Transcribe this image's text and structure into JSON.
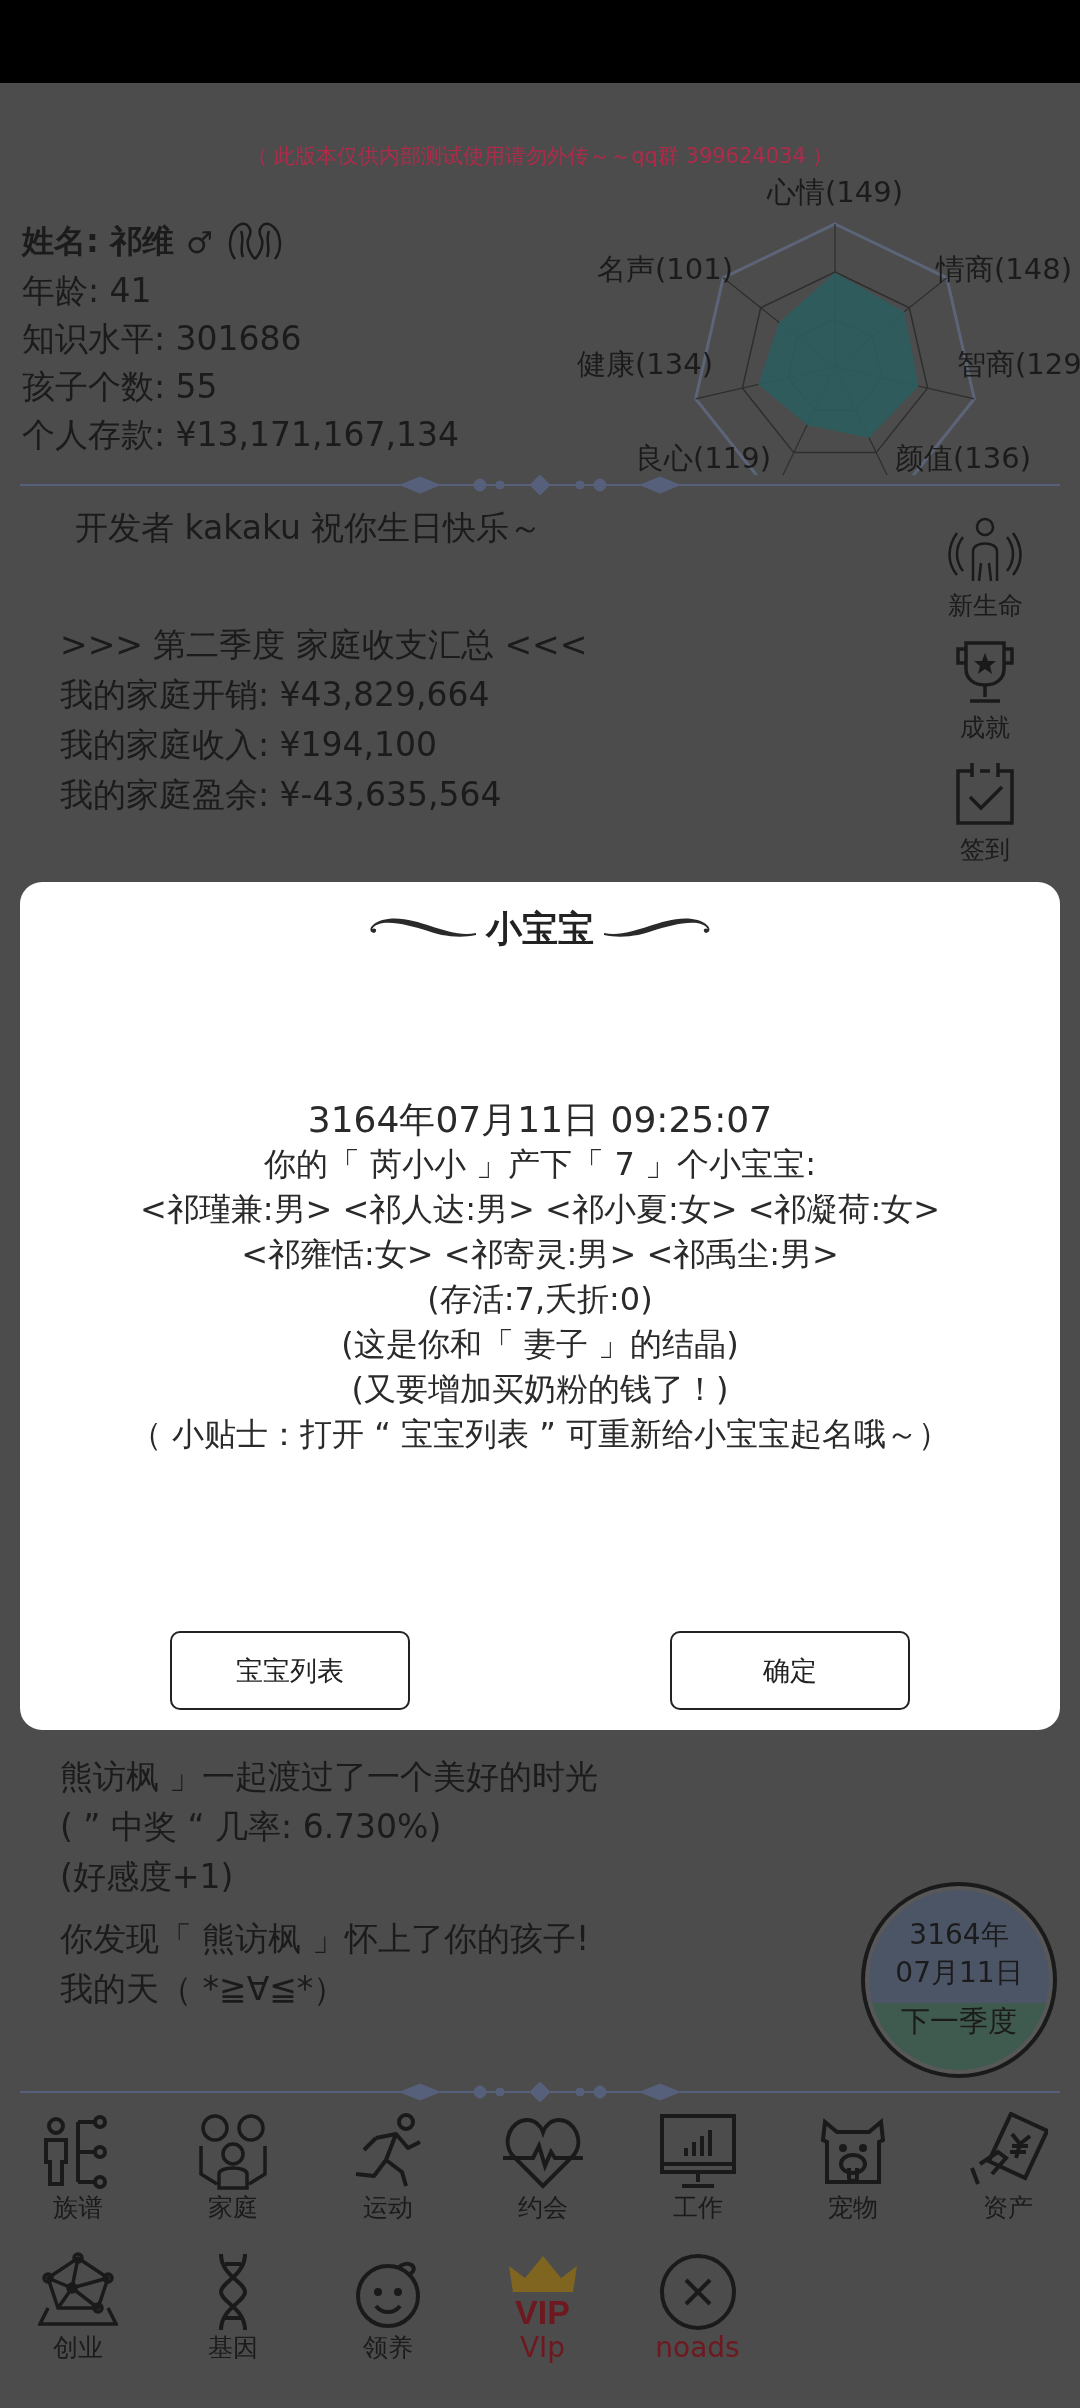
{
  "notice": "（ 此版本仅供内部测试使用请勿外传～～qq群 399624034 ）",
  "profile": {
    "name": "姓名: 祁维",
    "gender": "♂",
    "stats": [
      "年龄: 41",
      "知识水平: 301686",
      "孩子个数: 55",
      "个人存款: ¥13,171,167,134"
    ]
  },
  "radar": {
    "labels": [
      "心情(149)",
      "名声(101)",
      "情商(148)",
      "健康(134)",
      "智商(129",
      "良心(119)",
      "颜值(136)"
    ]
  },
  "greeting": "开发者 kakaku 祝你生日快乐～",
  "summary": {
    "title": ">>> 第二季度 家庭收支汇总 <<<",
    "lines": [
      "我的家庭开销: ¥43,829,664",
      "我的家庭收入: ¥194,100",
      "我的家庭盈余: ¥-43,635,564"
    ]
  },
  "side_buttons": [
    {
      "label": "新生命",
      "kind": "person"
    },
    {
      "label": "成就",
      "kind": "trophy"
    },
    {
      "label": "签到",
      "kind": "calendar"
    }
  ],
  "log": [
    [
      "熊访枫 」一起渡过了一个美好的时光",
      "( ” 中奖 “ 几率: 6.730%)",
      "(好感度+1)"
    ],
    [
      "你发现「 熊访枫 」怀上了你的孩子!",
      "我的天（ *≧∀≦*）"
    ]
  ],
  "date_button": {
    "year": "3164年",
    "date": "07月11日",
    "action": "下一季度"
  },
  "menu": [
    {
      "label": "族谱",
      "kind": "tree"
    },
    {
      "label": "家庭",
      "kind": "family"
    },
    {
      "label": "运动",
      "kind": "run"
    },
    {
      "label": "约会",
      "kind": "heart"
    },
    {
      "label": "工作",
      "kind": "monitor"
    },
    {
      "label": "宠物",
      "kind": "pig"
    },
    {
      "label": "资产",
      "kind": "money"
    },
    {
      "label": "创业",
      "kind": "network"
    },
    {
      "label": "基因",
      "kind": "dna"
    },
    {
      "label": "领养",
      "kind": "baby"
    },
    {
      "label": "VIp",
      "kind": "vip",
      "badge": "VIP"
    },
    {
      "label": "noads",
      "kind": "noads"
    }
  ],
  "dialog": {
    "title": "小宝宝",
    "datetime": "3164年07月11日  09:25:07",
    "lines": [
      "你的「 芮小小 」产下「 7 」个小宝宝:",
      "<祁瑾兼:男>  <祁人达:男>  <祁小夏:女>  <祁凝荷:女>",
      "<祁雍恬:女>  <祁寄灵:男>  <祁禹尘:男>",
      "(存活:7,夭折:0)",
      "(这是你和「 妻子 」的结晶)",
      "(又要增加买奶粉的钱了！)",
      "（ 小贴士：打开 “ 宝宝列表 ” 可重新给小宝宝起名哦～）"
    ],
    "buttons": [
      "宝宝列表",
      "确定"
    ]
  }
}
